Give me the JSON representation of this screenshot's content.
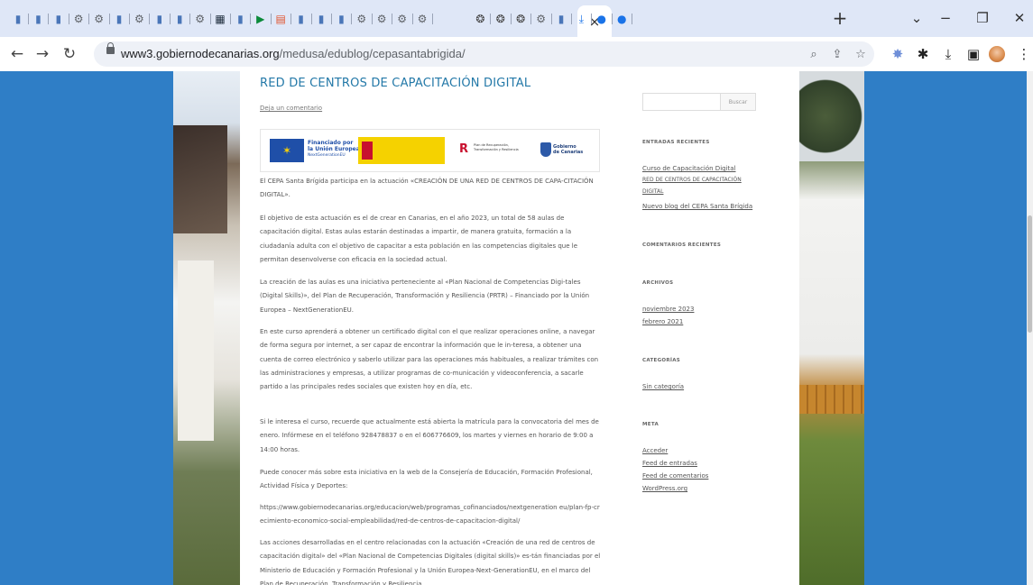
{
  "browser": {
    "url_host": "www3.gobiernodecanarias.org",
    "url_path": "/medusa/edublog/cepasantabrigida/",
    "active_tab_close": "×",
    "new_tab": "+",
    "window_controls": {
      "menu": "⌄",
      "minimize": "−",
      "restore": "❐",
      "close": "✕"
    }
  },
  "tabs": [
    {
      "icon": "page-icon",
      "color": "#4a76b8"
    },
    {
      "icon": "page-icon",
      "color": "#4a76b8"
    },
    {
      "icon": "page-icon",
      "color": "#4a76b8"
    },
    {
      "icon": "gear-icon",
      "color": "#5f6368"
    },
    {
      "icon": "gear-icon",
      "color": "#5f6368"
    },
    {
      "icon": "page-icon",
      "color": "#4a76b8"
    },
    {
      "icon": "gear-icon",
      "color": "#5f6368"
    },
    {
      "icon": "page-icon",
      "color": "#4a76b8"
    },
    {
      "icon": "page-icon",
      "color": "#4a76b8"
    },
    {
      "icon": "gear-icon",
      "color": "#5f6368"
    },
    {
      "icon": "app-icon",
      "color": "#1d2c3c"
    },
    {
      "icon": "page-icon",
      "color": "#4a76b8"
    },
    {
      "icon": "play-icon",
      "color": "#0b8a3a"
    },
    {
      "icon": "image-icon",
      "color": "#e0542e"
    },
    {
      "icon": "page-icon",
      "color": "#4a76b8"
    },
    {
      "icon": "page-icon",
      "color": "#4a76b8"
    },
    {
      "icon": "page-icon",
      "color": "#4a76b8"
    },
    {
      "icon": "gear-icon",
      "color": "#5f6368"
    },
    {
      "icon": "gear-icon",
      "color": "#5f6368"
    },
    {
      "icon": "gear-icon",
      "color": "#5f6368"
    },
    {
      "icon": "gear-icon",
      "color": "#5f6368"
    },
    {
      "icon": "chatgpt-icon",
      "color": "#444"
    },
    {
      "icon": "chatgpt-icon",
      "color": "#444"
    },
    {
      "icon": "chatgpt-icon",
      "color": "#444"
    },
    {
      "icon": "gear-icon",
      "color": "#5f6368"
    },
    {
      "icon": "page-icon",
      "color": "#4a76b8"
    },
    {
      "icon": "download-icon",
      "color": "#1a73e8"
    },
    {
      "icon": "circle-icon",
      "color": "#1a73e8"
    },
    {
      "icon": "circle-icon",
      "color": "#1a73e8"
    }
  ],
  "post": {
    "title": "RED DE CENTROS DE CAPACITACIÓN DIGITAL",
    "comment_link": "Deja un comentario",
    "logos": {
      "eu_line1": "Financiado por",
      "eu_line2": "la Unión Europea",
      "eu_line3": "NextGenerationEU",
      "prtr": "Plan de Recuperación, Transformación y Resiliencia",
      "gob_line1": "Gobierno",
      "gob_line2": "de Canarias"
    },
    "paragraphs": [
      "El CEPA Santa Brígida participa en la actuación «CREACIÓN DE UNA RED DE CENTROS DE CAPA-CITACIÓN DIGITAL».",
      "El objetivo de esta actuación es el de crear en Canarias, en el año 2023, un total de 58 aulas de capacitación digital. Estas aulas estarán destinadas a impartir, de manera gratuita, formación a la ciudadanía adulta con el objetivo de capacitar a esta población en las competencias digitales que le permitan desenvolverse con eficacia en la sociedad actual.",
      "La creación de las aulas es una iniciativa perteneciente al «Plan Nacional de Competencias Digi-tales (Digital Skills)», del Plan de Recuperación, Transformación y Resiliencia (PRTR) – Financiado por la Unión Europea – NextGenerationEU.",
      "En este curso aprenderá a obtener un certificado digital con el que realizar operaciones online, a navegar de forma segura por internet, a ser capaz de encontrar la información que le in-teresa, a obtener una cuenta de correo electrónico y saberlo utilizar para las operaciones más habituales, a realizar trámites con las administraciones y empresas, a utilizar programas de co-municación y videoconferencia, a sacarle partido a las principales redes sociales que existen hoy en día, etc.",
      "Si le interesa el curso, recuerde que actualmente está abierta la matrícula para la convocatoria del mes de enero. Infórmese en el teléfono 928478837 o en el 606776609, los martes y viernes en horario de 9:00 a 14:00 horas.",
      "Puede conocer más sobre esta iniciativa en la web de la Consejería de Educación, Formación Profesional, Actividad Física y Deportes:",
      "https://www.gobiernodecanarias.org/educacion/web/programas_cofinanciados/nextgeneration eu/plan-fp-crecimiento-economico-social-empleabilidad/red-de-centros-de-capacitacion-digital/",
      "Las acciones desarrolladas en el centro relacionadas con la actuación «Creación de una red de centros de capacitación digital» del «Plan Nacional de Competencias Digitales (digital skills)» es-tán financiadas por el Ministerio de Educación y Formación Profesional y la Unión Europea-Next-GenerationEU, en el marco del Plan de Recuperación, Transformación y Resiliencia."
    ]
  },
  "sidebar": {
    "search_button": "Buscar",
    "recent_title": "ENTRADAS RECIENTES",
    "recent": [
      "Curso de Capacitación Digital",
      "RED DE CENTROS DE CAPACITACIÓN",
      "DIGITAL",
      "Nuevo blog del CEPA Santa Brígida"
    ],
    "comments_title": "COMENTARIOS RECIENTES",
    "archives_title": "ARCHIVOS",
    "archives": [
      "noviembre 2023",
      "febrero 2021"
    ],
    "categories_title": "CATEGORÍAS",
    "categories": [
      "Sin categoría"
    ],
    "meta_title": "META",
    "meta": [
      "Acceder",
      "Feed de entradas",
      "Feed de comentarios",
      "WordPress.org"
    ]
  }
}
